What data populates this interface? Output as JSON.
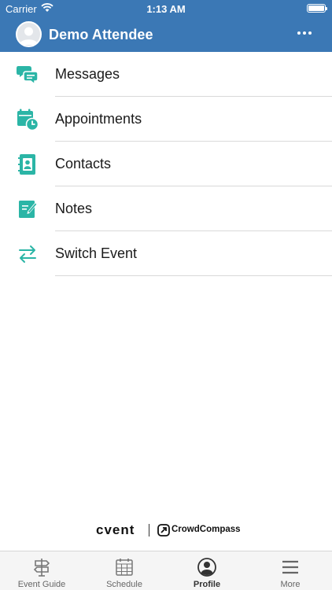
{
  "status_bar": {
    "carrier": "Carrier",
    "time": "1:13 AM"
  },
  "header": {
    "user_name": "Demo Attendee",
    "more_icon": "ellipsis-icon",
    "color": "#3b78b5"
  },
  "menu": {
    "items": [
      {
        "label": "Messages",
        "icon": "chat-bubbles-icon"
      },
      {
        "label": "Appointments",
        "icon": "calendar-clock-icon"
      },
      {
        "label": "Contacts",
        "icon": "address-book-icon"
      },
      {
        "label": "Notes",
        "icon": "note-pencil-icon"
      },
      {
        "label": "Switch Event",
        "icon": "switch-arrows-icon"
      }
    ],
    "icon_color": "#2bb5a6"
  },
  "branding": {
    "cvent": "cvent",
    "crowdcompass": "CrowdCompass"
  },
  "tabbar": {
    "tabs": [
      {
        "label": "Event Guide",
        "icon": "signpost-icon",
        "active": false
      },
      {
        "label": "Schedule",
        "icon": "calendar-grid-icon",
        "active": false
      },
      {
        "label": "Profile",
        "icon": "user-circle-icon",
        "active": true
      },
      {
        "label": "More",
        "icon": "menu-lines-icon",
        "active": false
      }
    ]
  }
}
